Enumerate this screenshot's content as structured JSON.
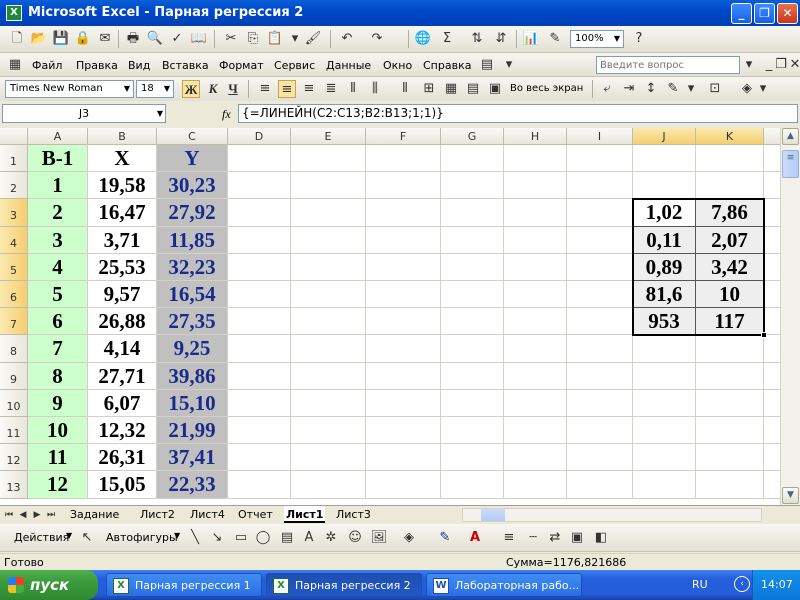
{
  "window": {
    "title": "Microsoft Excel - Парная регрессия 2",
    "app_icon": "excel-icon",
    "buttons": [
      "minimize",
      "restore",
      "close"
    ]
  },
  "standard_toolbar": {
    "zoom": "100%",
    "icons": [
      "new-icon",
      "open-icon",
      "save-icon",
      "permission-icon",
      "email-icon",
      "print-icon",
      "print-preview-icon",
      "spelling-icon",
      "research-icon",
      "cut-icon",
      "copy-icon",
      "paste-icon",
      "format-painter-icon",
      "undo-icon",
      "redo-icon",
      "hyperlink-icon",
      "autosum-icon",
      "sort-ascending-icon",
      "sort-descending-icon",
      "chart-wizard-icon",
      "drawing-icon",
      "help-icon"
    ]
  },
  "menu": {
    "items": [
      "Файл",
      "Правка",
      "Вид",
      "Вставка",
      "Формат",
      "Сервис",
      "Данные",
      "Окно",
      "Справка"
    ],
    "help_placeholder": "Введите вопрос"
  },
  "format_toolbar": {
    "font": "Times New Roman",
    "size": "18",
    "bold": "Ж",
    "italic": "К",
    "underline": "Ч",
    "full_screen": "Во весь экран"
  },
  "formula_bar": {
    "name_box": "J3",
    "fx": "fx",
    "formula": "{=ЛИНЕЙН(C2:C13;B2:B13;1;1)}"
  },
  "grid": {
    "columns": [
      "A",
      "B",
      "C",
      "D",
      "E",
      "F",
      "G",
      "H",
      "I",
      "J",
      "K"
    ],
    "rows": [
      "1",
      "2",
      "3",
      "4",
      "5",
      "6",
      "7",
      "8",
      "9",
      "10",
      "11",
      "12",
      "13"
    ],
    "header_row": [
      "В-1",
      "X",
      "Y"
    ],
    "data": [
      [
        "1",
        "19,58",
        "30,23"
      ],
      [
        "2",
        "16,47",
        "27,92"
      ],
      [
        "3",
        "3,71",
        "11,85"
      ],
      [
        "4",
        "25,53",
        "32,23"
      ],
      [
        "5",
        "9,57",
        "16,54"
      ],
      [
        "6",
        "26,88",
        "27,35"
      ],
      [
        "7",
        "4,14",
        "9,25"
      ],
      [
        "8",
        "27,71",
        "39,86"
      ],
      [
        "9",
        "6,07",
        "15,10"
      ],
      [
        "10",
        "12,32",
        "21,99"
      ],
      [
        "11",
        "26,31",
        "37,41"
      ],
      [
        "12",
        "15,05",
        "22,33"
      ]
    ],
    "linest": [
      [
        "1,02",
        "7,86"
      ],
      [
        "0,11",
        "2,07"
      ],
      [
        "0,89",
        "3,42"
      ],
      [
        "81,6",
        "10"
      ],
      [
        "953",
        "117"
      ]
    ],
    "colors": {
      "col_a": "#ccffcc",
      "col_c": "#c0c0c0",
      "y_text": "#1a2a8c",
      "selection_header": "#f5cf6e"
    }
  },
  "sheet_tabs": {
    "tabs": [
      "Задание",
      "Лист2",
      "Лист4",
      "Отчет",
      "Лист1",
      "Лист3"
    ],
    "active": "Лист1"
  },
  "drawing_toolbar": {
    "actions": "Действия",
    "autoshapes": "Автофигуры"
  },
  "status_bar": {
    "ready": "Готово",
    "sum": "Сумма=1176,821686"
  },
  "taskbar": {
    "start": "пуск",
    "tasks": [
      "Парная регрессия 1",
      "Парная регрессия 2",
      "Лабораторная рабо..."
    ],
    "lang": "RU",
    "time": "14:07"
  }
}
